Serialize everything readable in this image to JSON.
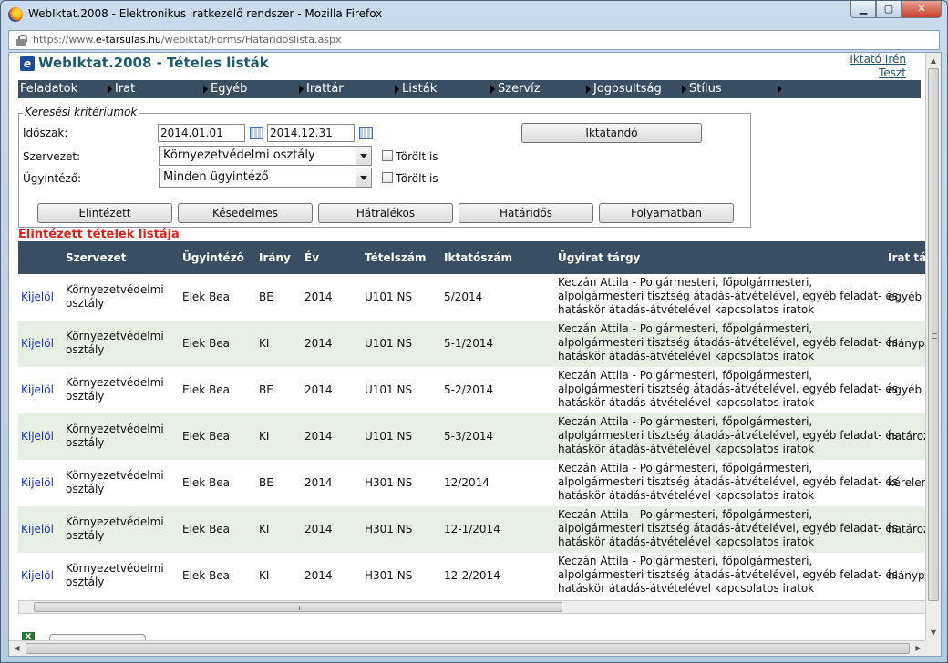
{
  "window": {
    "title": "WebIktat.2008 - Elektronikus iratkezelő rendszer - Mozilla Firefox",
    "buttons": {
      "minimize": "▁",
      "maximize": "▢",
      "close": "✕"
    }
  },
  "urlbar": {
    "prefix": "https://www.",
    "host": "e-tarsulas.hu",
    "path": "/webiktat/Forms/Hataridoslista.aspx"
  },
  "header": {
    "logo_letter": "e",
    "title": "WebIktat.2008 - Tételes listák",
    "user_name": "Iktató Irén",
    "user_sub": "Teszt"
  },
  "menu": {
    "items": [
      "Feladatok",
      "Irat",
      "Egyéb",
      "Irattár",
      "Listák",
      "Szervíz",
      "Jogosultság",
      "Stílus"
    ]
  },
  "criteria": {
    "legend": "Keresési kritériumok",
    "period_label": "Időszak:",
    "date_from": "2014.01.01",
    "date_to": "2014.12.31",
    "org_label": "Szervezet:",
    "org_value": "Környezetvédelmi osztály",
    "handler_label": "Ügyintéző:",
    "handler_value": "Minden ügyintéző",
    "deleted_label": "Törölt is",
    "iktatando_button": "Iktatandó",
    "filter_buttons": [
      "Elintézett",
      "Késedelmes",
      "Hátralékos",
      "Határidős",
      "Folyamatban"
    ]
  },
  "list": {
    "title": "Elintézett tételek listája",
    "columns": [
      "Szervezet",
      "Ügyintéző",
      "Irány",
      "Év",
      "Tételszám",
      "Iktatószám",
      "Ügyirat tárgy",
      "Irat tá"
    ],
    "rows": [
      {
        "select": "Kijelöl",
        "org1": "Környezetvédelmi",
        "org2": "osztály",
        "handler": "Elek Bea",
        "dir": "BE",
        "year": "2014",
        "item": "U101 NS",
        "reg": "5/2014",
        "subj1": "Keczán Attila - Polgármesteri, főpolgármesteri,",
        "subj2": "alpolgármesteri tisztség átadás-átvételével, egyéb feladat- és",
        "subj3": "hatáskör átadás-átvételével kapcsolatos iratok",
        "type": "egyéb"
      },
      {
        "select": "Kijelöl",
        "org1": "Környezetvédelmi",
        "org2": "osztály",
        "handler": "Elek Bea",
        "dir": "KI",
        "year": "2014",
        "item": "U101 NS",
        "reg": "5-1/2014",
        "subj1": "Keczán Attila - Polgármesteri, főpolgármesteri,",
        "subj2": "alpolgármesteri tisztség átadás-átvételével, egyéb feladat- és",
        "subj3": "hatáskör átadás-átvételével kapcsolatos iratok",
        "type": "hiánypó"
      },
      {
        "select": "Kijelöl",
        "org1": "Környezetvédelmi",
        "org2": "osztály",
        "handler": "Elek Bea",
        "dir": "BE",
        "year": "2014",
        "item": "U101 NS",
        "reg": "5-2/2014",
        "subj1": "Keczán Attila - Polgármesteri, főpolgármesteri,",
        "subj2": "alpolgármesteri tisztség átadás-átvételével, egyéb feladat- és",
        "subj3": "hatáskör átadás-átvételével kapcsolatos iratok",
        "type": "egyéb"
      },
      {
        "select": "Kijelöl",
        "org1": "Környezetvédelmi",
        "org2": "osztály",
        "handler": "Elek Bea",
        "dir": "KI",
        "year": "2014",
        "item": "U101 NS",
        "reg": "5-3/2014",
        "subj1": "Keczán Attila - Polgármesteri, főpolgármesteri,",
        "subj2": "alpolgármesteri tisztség átadás-átvételével, egyéb feladat- és",
        "subj3": "hatáskör átadás-átvételével kapcsolatos iratok",
        "type": "határoz"
      },
      {
        "select": "Kijelöl",
        "org1": "Környezetvédelmi",
        "org2": "osztály",
        "handler": "Elek Bea",
        "dir": "BE",
        "year": "2014",
        "item": "H301 NS",
        "reg": "12/2014",
        "subj1": "Keczán Attila - Polgármesteri, főpolgármesteri,",
        "subj2": "alpolgármesteri tisztség átadás-átvételével, egyéb feladat- és",
        "subj3": "hatáskör átadás-átvételével kapcsolatos iratok",
        "type": "kérelem"
      },
      {
        "select": "Kijelöl",
        "org1": "Környezetvédelmi",
        "org2": "osztály",
        "handler": "Elek Bea",
        "dir": "KI",
        "year": "2014",
        "item": "H301 NS",
        "reg": "12-1/2014",
        "subj1": "Keczán Attila - Polgármesteri, főpolgármesteri,",
        "subj2": "alpolgármesteri tisztség átadás-átvételével, egyéb feladat- és",
        "subj3": "hatáskör átadás-átvételével kapcsolatos iratok",
        "type": "határoz"
      },
      {
        "select": "Kijelöl",
        "org1": "Környezetvédelmi",
        "org2": "osztály",
        "handler": "Elek Bea",
        "dir": "KI",
        "year": "2014",
        "item": "H301 NS",
        "reg": "12-2/2014",
        "subj1": "Keczán Attila - Polgármesteri, főpolgármesteri,",
        "subj2": "alpolgármesteri tisztség átadás-átvételével, egyéb feladat- és",
        "subj3": "hatáskör átadás-átvételével kapcsolatos iratok",
        "type": "hiánypó"
      }
    ]
  },
  "footer": {
    "excel_icon": "X"
  }
}
